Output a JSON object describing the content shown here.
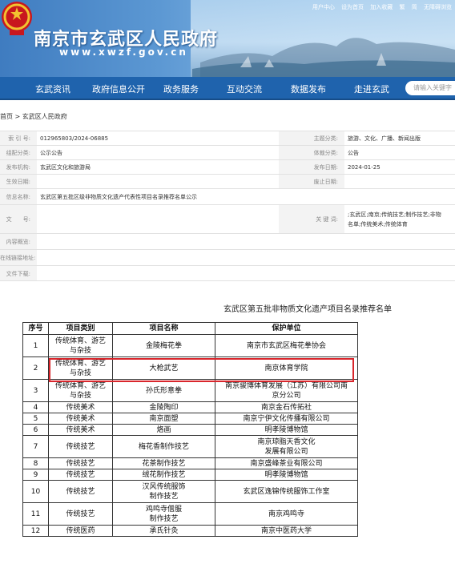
{
  "header": {
    "top_links": [
      "用户中心",
      "设为首页",
      "加入收藏",
      "繁",
      "简",
      "无障碍浏览"
    ],
    "site_title": "南京市玄武区人民政府",
    "site_url": "www.xwzf.gov.cn"
  },
  "nav": {
    "items": [
      "玄武资讯",
      "政府信息公开",
      "政务服务",
      "互动交流",
      "数据发布",
      "走进玄武"
    ],
    "search_placeholder": "请输入关键字"
  },
  "breadcrumb": "首页 > 玄武区人民政府",
  "meta": {
    "index_label": "索 引 号:",
    "index_value": "012965803/2024-06885",
    "topic_label": "主题分类:",
    "topic_value": "旅游、文化、广播、新闻出版",
    "category_label": "组配分类:",
    "category_value": "公示公告",
    "genre_label": "体裁分类:",
    "genre_value": "公告",
    "org_label": "发布机构:",
    "org_value": "玄武区文化和旅游局",
    "pubdate_label": "发布日期:",
    "pubdate_value": "2024-01-25",
    "effective_label": "生效日期:",
    "effective_value": "",
    "expiry_label": "废止日期:",
    "expiry_value": "",
    "name_label": "信息名称:",
    "name_value": "玄武区第五批区级非物质文化遗产代表性项目名录推荐名单公示",
    "docno_label": "文　　号:",
    "docno_value": "",
    "keywords_label": "关 键 词:",
    "keywords_line1": ";玄武区;南京;传统技艺;制作技艺;非物",
    "keywords_line2": "名单;传统美术;传统体育",
    "summary_label": "内容概览:",
    "summary_value": "",
    "online_label": "在线链接地址:",
    "online_value": "",
    "download_label": "文件下载:",
    "download_value": ""
  },
  "document": {
    "title": "玄武区第五批非物质文化遗产项目名录推荐名单",
    "headers": [
      "序号",
      "项目类别",
      "项目名称",
      "保护单位"
    ],
    "rows": [
      [
        "1",
        "传统体育、游艺|与杂技",
        "金陵梅花拳",
        "南京市玄武区梅花拳协会"
      ],
      [
        "2",
        "传统体育、游艺|与杂技",
        "大枪武艺",
        "南京体育学院"
      ],
      [
        "3",
        "传统体育、游艺|与杂技",
        "孙氏形意拳",
        "南京骏博体育发展（江苏）有限公司南|京分公司"
      ],
      [
        "4",
        "传统美术",
        "金陵陶印",
        "南京金石传拓社"
      ],
      [
        "5",
        "传统美术",
        "南京面塑",
        "南京宁伊文化传播有限公司"
      ],
      [
        "6",
        "传统美术",
        "烙画",
        "明孝陵博物馆"
      ],
      [
        "7",
        "传统技艺",
        "梅花香制作技艺",
        "南京琼脂天香文化|发展有限公司"
      ],
      [
        "8",
        "传统技艺",
        "花茶制作技艺",
        "南京盛峰茶业有限公司"
      ],
      [
        "9",
        "传统技艺",
        "绒花制作技艺",
        "明孝陵博物馆"
      ],
      [
        "10",
        "传统技艺",
        "汉风传统服饰|制作技艺",
        "玄武区逸锦传统服饰工作室"
      ],
      [
        "11",
        "传统技艺",
        "鸡鸣寺僧服|制作技艺",
        "南京鸡鸣寺"
      ],
      [
        "12",
        "传统医药",
        "承氏针灸",
        "南京中医药大学"
      ]
    ]
  }
}
